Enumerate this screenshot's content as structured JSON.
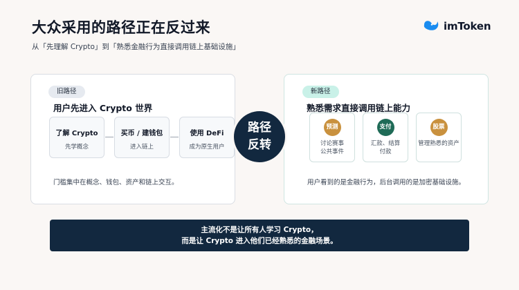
{
  "header": {
    "title": "大众采用的路径正在反过来",
    "subtitle": "从「先理解 Crypto」到「熟悉金融行为直接调用链上基础设施」"
  },
  "brand": {
    "name": "imToken",
    "color": "#1a8cf0"
  },
  "old_path": {
    "tag": "旧路径",
    "heading": "用户先进入 Crypto 世界",
    "steps": [
      {
        "title": "了解 Crypto",
        "sub": "先学概念"
      },
      {
        "title": "买币 / 建钱包",
        "sub": "进入链上"
      },
      {
        "title": "使用 DeFi",
        "sub": "成为原生用户"
      }
    ],
    "note": "门槛集中在概念、钱包、资产和链上交互。"
  },
  "center": {
    "line1": "路径",
    "line2": "反转"
  },
  "new_path": {
    "tag": "新路径",
    "heading": "熟悉需求直接调用链上能力",
    "features": [
      {
        "badge": "预测",
        "text1": "讨论赛事",
        "text2": "公共事件",
        "color": "#c9913e"
      },
      {
        "badge": "支付",
        "text1": "汇款、结算",
        "text2": "付款",
        "color": "#1f6b57"
      },
      {
        "badge": "股票",
        "text1": "管理熟悉的资产",
        "text2": "",
        "color": "#c9913e"
      }
    ],
    "note": "用户看到的是金融行为，后台调用的是加密基础设施。"
  },
  "banner": {
    "line1": "主流化不是让所有人学习 Crypto，",
    "line2": "而是让 Crypto 进入他们已经熟悉的金融场景。"
  },
  "colors": {
    "navy": "#12283f",
    "background": "#faf7f5",
    "mint_tag": "#c9f1e8"
  }
}
